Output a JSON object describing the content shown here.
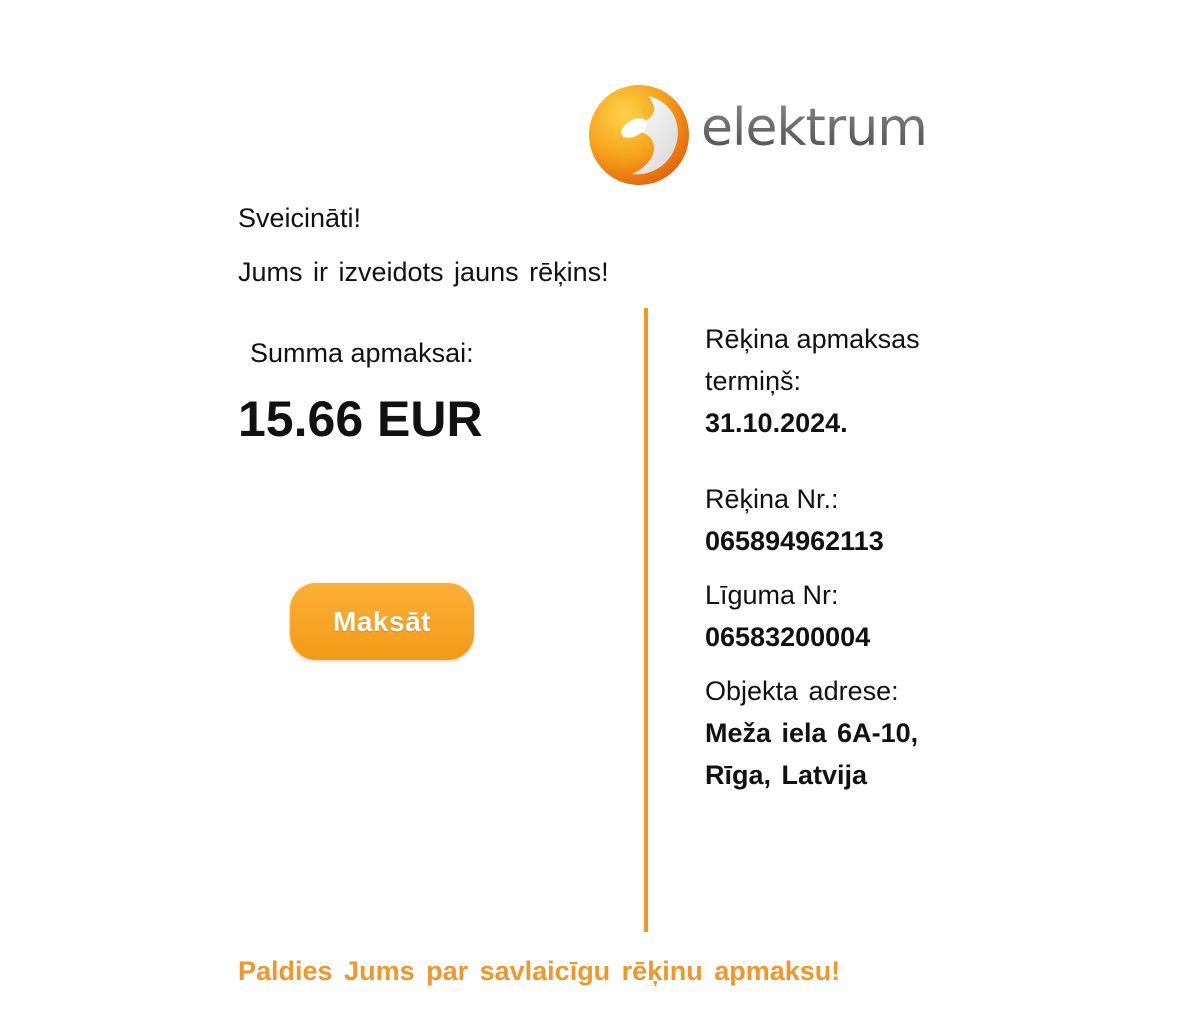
{
  "logo": {
    "text": "elektrum",
    "brand_orange": "#f39a17",
    "mark_icon": "elektrum-swirl-logo-icon"
  },
  "greeting": "Sveicināti!",
  "intro": "Jums ir izveidots jauns rēķins!",
  "amount": {
    "label": "Summa apmaksai:",
    "value": "15.66 EUR"
  },
  "pay_button": {
    "label": "Maksāt",
    "color": "#f7a323"
  },
  "details": {
    "due_label": "Rēķina apmaksas termiņš:",
    "due_value": "31.10.2024.",
    "invoice_label": "Rēķina Nr.:",
    "invoice_value": "065894962113",
    "contract_label": "Līguma Nr:",
    "contract_value": "06583200004",
    "address_label": "Objekta adrese:",
    "address_value": "Meža iela 6A-10, Rīga, Latvija"
  },
  "divider_color": "#f0962a",
  "thanks": "Paldies Jums par savlaicīgu rēķinu apmaksu!"
}
